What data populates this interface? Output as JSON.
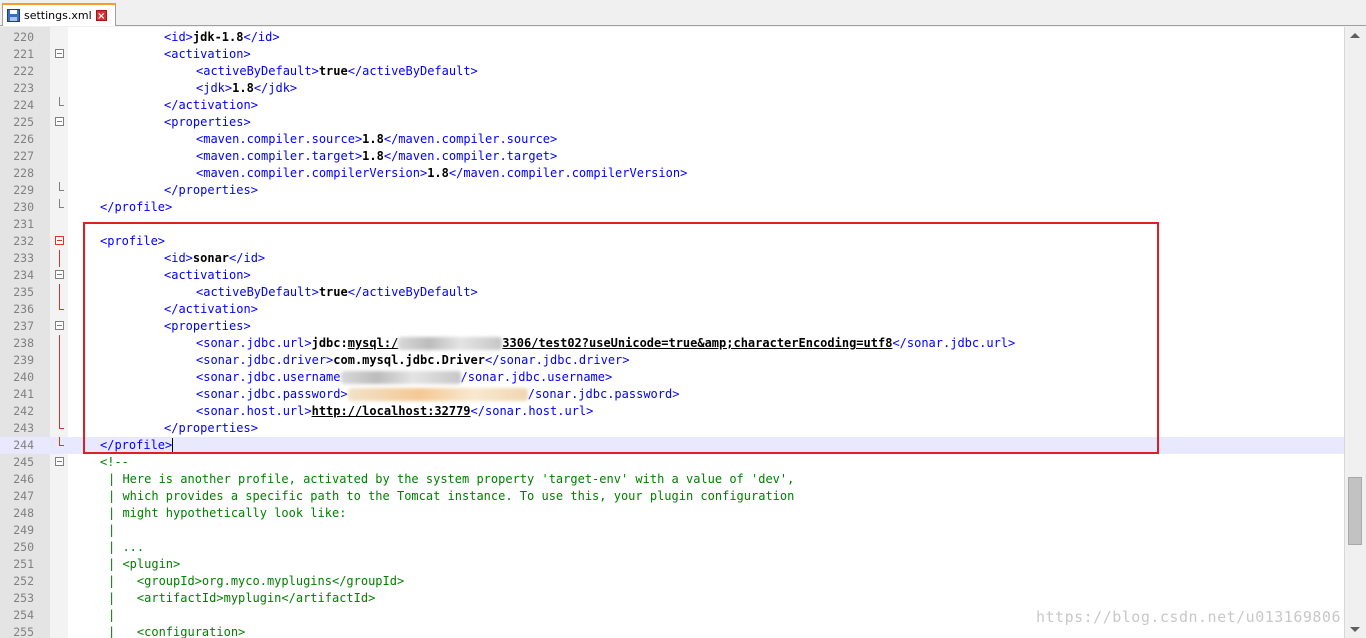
{
  "tab": {
    "filename": "settings.xml",
    "close_glyph": "×",
    "save_icon": "floppy-disk-icon",
    "close_icon": "close-icon"
  },
  "colors": {
    "tag": "#0000ff",
    "text": "#000000",
    "comment": "#008000",
    "highlight_box": "#e02020",
    "active_tab_accent": "#fa9b28",
    "current_line": "#e8e8ff"
  },
  "lines": [
    {
      "num": "220",
      "fold": "none",
      "ind": 12,
      "segs": [
        {
          "t": "<id>",
          "c": "tag"
        },
        {
          "t": "jdk-1.8",
          "c": "txt"
        },
        {
          "t": "</id>",
          "c": "tag"
        }
      ]
    },
    {
      "num": "221",
      "fold": "open",
      "ind": 12,
      "segs": [
        {
          "t": "<activation>",
          "c": "tag"
        }
      ]
    },
    {
      "num": "222",
      "fold": "none",
      "ind": 16,
      "segs": [
        {
          "t": "<activeByDefault>",
          "c": "tag"
        },
        {
          "t": "true",
          "c": "txt"
        },
        {
          "t": "</activeByDefault>",
          "c": "tag"
        }
      ]
    },
    {
      "num": "223",
      "fold": "none",
      "ind": 16,
      "segs": [
        {
          "t": "<jdk>",
          "c": "tag"
        },
        {
          "t": "1.8",
          "c": "txt"
        },
        {
          "t": "</jdk>",
          "c": "tag"
        }
      ]
    },
    {
      "num": "224",
      "fold": "end",
      "ind": 12,
      "segs": [
        {
          "t": "</activation>",
          "c": "tag"
        }
      ]
    },
    {
      "num": "225",
      "fold": "open",
      "ind": 12,
      "segs": [
        {
          "t": "<properties>",
          "c": "tag"
        }
      ]
    },
    {
      "num": "226",
      "fold": "none",
      "ind": 16,
      "segs": [
        {
          "t": "<maven.compiler.source>",
          "c": "tag"
        },
        {
          "t": "1.8",
          "c": "txt"
        },
        {
          "t": "</maven.compiler.source>",
          "c": "tag"
        }
      ]
    },
    {
      "num": "227",
      "fold": "none",
      "ind": 16,
      "segs": [
        {
          "t": "<maven.compiler.target>",
          "c": "tag"
        },
        {
          "t": "1.8",
          "c": "txt"
        },
        {
          "t": "</maven.compiler.target>",
          "c": "tag"
        }
      ]
    },
    {
      "num": "228",
      "fold": "none",
      "ind": 16,
      "segs": [
        {
          "t": "<maven.compiler.compilerVersion>",
          "c": "tag"
        },
        {
          "t": "1.8",
          "c": "txt"
        },
        {
          "t": "</maven.compiler.compilerVersion>",
          "c": "tag"
        }
      ]
    },
    {
      "num": "229",
      "fold": "end",
      "ind": 12,
      "segs": [
        {
          "t": "</properties>",
          "c": "tag"
        }
      ]
    },
    {
      "num": "230",
      "fold": "end",
      "ind": 4,
      "segs": [
        {
          "t": "</profile>",
          "c": "tag"
        }
      ]
    },
    {
      "num": "231",
      "fold": "none",
      "ind": 0,
      "segs": []
    },
    {
      "num": "232",
      "fold": "open-red",
      "ind": 4,
      "segs": [
        {
          "t": "<profile>",
          "c": "tag"
        }
      ]
    },
    {
      "num": "233",
      "fold": "red",
      "ind": 12,
      "segs": [
        {
          "t": "<id>",
          "c": "tag"
        },
        {
          "t": "sonar",
          "c": "txt"
        },
        {
          "t": "</id>",
          "c": "tag"
        }
      ]
    },
    {
      "num": "234",
      "fold": "open",
      "ind": 12,
      "segs": [
        {
          "t": "<activation>",
          "c": "tag"
        }
      ]
    },
    {
      "num": "235",
      "fold": "red",
      "ind": 16,
      "segs": [
        {
          "t": "<activeByDefault>",
          "c": "tag"
        },
        {
          "t": "true",
          "c": "txt"
        },
        {
          "t": "</activeByDefault>",
          "c": "tag"
        }
      ]
    },
    {
      "num": "236",
      "fold": "end-red",
      "ind": 12,
      "segs": [
        {
          "t": "</activation>",
          "c": "tag"
        }
      ]
    },
    {
      "num": "237",
      "fold": "open",
      "ind": 12,
      "segs": [
        {
          "t": "<properties>",
          "c": "tag"
        }
      ]
    },
    {
      "num": "238",
      "fold": "red",
      "ind": 16,
      "segs": [
        {
          "t": "<sonar.jdbc.url>",
          "c": "tag"
        },
        {
          "t": "jdbc:",
          "c": "txt"
        },
        {
          "t": "mysql:/",
          "c": "ul"
        },
        {
          "t": "",
          "c": "blur",
          "w": 104
        },
        {
          "t": "3306/test02?useUnicode=true&amp;characterEncoding=utf8",
          "c": "ul"
        },
        {
          "t": "</sonar.jdbc.url>",
          "c": "tag"
        }
      ]
    },
    {
      "num": "239",
      "fold": "red",
      "ind": 16,
      "segs": [
        {
          "t": "<sonar.jdbc.driver>",
          "c": "tag"
        },
        {
          "t": "com.mysql.jdbc.Driver",
          "c": "txt"
        },
        {
          "t": "</sonar.jdbc.driver>",
          "c": "tag"
        }
      ]
    },
    {
      "num": "240",
      "fold": "red",
      "ind": 16,
      "segs": [
        {
          "t": "<sonar.jdbc.username",
          "c": "tag"
        },
        {
          "t": "",
          "c": "blur",
          "w": 120
        },
        {
          "t": "/sonar.jdbc.username>",
          "c": "tag"
        }
      ]
    },
    {
      "num": "241",
      "fold": "red",
      "ind": 16,
      "segs": [
        {
          "t": "<sonar.jdbc.password>",
          "c": "tag"
        },
        {
          "t": "",
          "c": "blur orange",
          "w": 180
        },
        {
          "t": "/sonar.jdbc.password>",
          "c": "tag"
        }
      ]
    },
    {
      "num": "242",
      "fold": "red",
      "ind": 16,
      "segs": [
        {
          "t": "<sonar.host.url>",
          "c": "tag"
        },
        {
          "t": "http://localhost:32779",
          "c": "ul"
        },
        {
          "t": "</sonar.host.url>",
          "c": "tag"
        }
      ]
    },
    {
      "num": "243",
      "fold": "end-red",
      "ind": 12,
      "segs": [
        {
          "t": "</properties>",
          "c": "tag"
        }
      ]
    },
    {
      "num": "244",
      "fold": "end-red",
      "ind": 4,
      "current": true,
      "segs": [
        {
          "t": "</profile>",
          "c": "tag"
        },
        {
          "t": "",
          "c": "caret"
        }
      ]
    },
    {
      "num": "245",
      "fold": "open",
      "ind": 4,
      "segs": [
        {
          "t": "<!--",
          "c": "cmt"
        }
      ]
    },
    {
      "num": "246",
      "fold": "none",
      "ind": 5,
      "segs": [
        {
          "t": "| Here is another profile, activated by the system property 'target-env' with a value of 'dev',",
          "c": "cmt"
        }
      ]
    },
    {
      "num": "247",
      "fold": "none",
      "ind": 5,
      "segs": [
        {
          "t": "| which provides a specific path to the Tomcat instance. To use this, your plugin configuration",
          "c": "cmt"
        }
      ]
    },
    {
      "num": "248",
      "fold": "none",
      "ind": 5,
      "segs": [
        {
          "t": "| might hypothetically look like:",
          "c": "cmt"
        }
      ]
    },
    {
      "num": "249",
      "fold": "none",
      "ind": 5,
      "segs": [
        {
          "t": "|",
          "c": "cmt"
        }
      ]
    },
    {
      "num": "250",
      "fold": "none",
      "ind": 5,
      "segs": [
        {
          "t": "| ...",
          "c": "cmt"
        }
      ]
    },
    {
      "num": "251",
      "fold": "none",
      "ind": 5,
      "segs": [
        {
          "t": "| <plugin>",
          "c": "cmt"
        }
      ]
    },
    {
      "num": "252",
      "fold": "none",
      "ind": 5,
      "segs": [
        {
          "t": "|   <groupId>org.myco.myplugins</groupId>",
          "c": "cmt"
        }
      ]
    },
    {
      "num": "253",
      "fold": "none",
      "ind": 5,
      "segs": [
        {
          "t": "|   <artifactId>myplugin</artifactId>",
          "c": "cmt"
        }
      ]
    },
    {
      "num": "254",
      "fold": "none",
      "ind": 5,
      "segs": [
        {
          "t": "|",
          "c": "cmt"
        }
      ]
    },
    {
      "num": "255",
      "fold": "none",
      "ind": 5,
      "segs": [
        {
          "t": "|   <configuration>",
          "c": "cmt"
        }
      ]
    }
  ],
  "watermark": "https://blog.csdn.net/u013169806"
}
